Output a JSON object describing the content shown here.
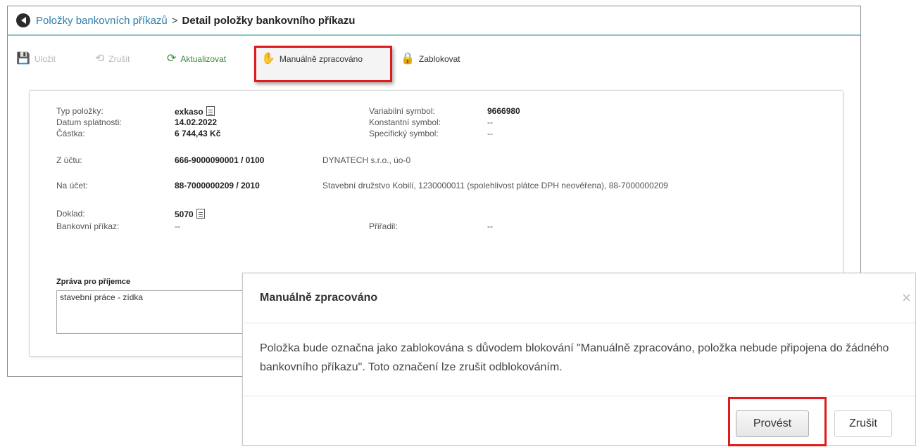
{
  "breadcrumb": {
    "parent": "Položky bankovních příkazů",
    "separator": ">",
    "current": "Detail položky bankovního příkazu"
  },
  "toolbar": {
    "save": "Uložit",
    "cancel": "Zrušit",
    "refresh": "Aktualizovat",
    "manual": "Manuálně zpracováno",
    "block": "Zablokovat"
  },
  "detail": {
    "type_label": "Typ položky:",
    "type_value": "exkaso",
    "due_label": "Datum splatnosti:",
    "due_value": "14.02.2022",
    "amount_label": "Částka:",
    "amount_value": "6 744,43 Kč",
    "vs_label": "Variabilní symbol:",
    "vs_value": "9666980",
    "ks_label": "Konstantní symbol:",
    "ks_value": "--",
    "ss_label": "Specifický symbol:",
    "ss_value": "--",
    "from_label": "Z účtu:",
    "from_value": "666-9000090001 / 0100",
    "from_name": "DYNATECH s.r.o., úo-0",
    "to_label": "Na účet:",
    "to_value": "88-7000000209 / 2010",
    "to_name": "Stavební družstvo Kobilí, 1230000011 (spolehlivost plátce DPH neověřena), 88-7000000209",
    "doc_label": "Doklad:",
    "doc_value": "5070",
    "order_label": "Bankovní příkaz:",
    "order_value": "--",
    "assign_label": "Přiřadil:",
    "assign_value": "--",
    "message_title": "Zpráva pro příjemce",
    "message_value": "stavební práce - zídka"
  },
  "modal": {
    "title": "Manuálně zpracováno",
    "close": "×",
    "body": "Položka bude označna jako zablokována s důvodem blokování \"Manuálně zpracováno, položka nebude připojena do žádného bankovního příkazu\". Toto označení lze zrušit odblokováním.",
    "confirm": "Provést",
    "cancel": "Zrušit"
  },
  "colors": {
    "highlight": "#e01b1b",
    "link": "#2f7fa8",
    "refresh": "#3a8a3a"
  }
}
